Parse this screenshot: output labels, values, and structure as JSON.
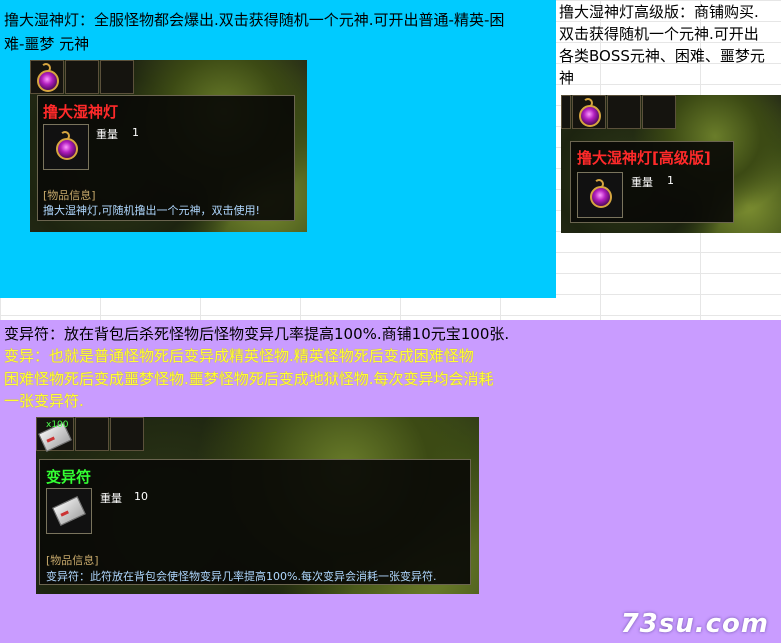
{
  "panel_top_left": {
    "desc_line1": "撸大湿神灯：全服怪物都会爆出.双击获得随机一个元神.可开出普通-精英-困",
    "desc_line2": "难-噩梦 元神",
    "tooltip": {
      "title": "撸大湿神灯",
      "title_color": "#ff2a2a",
      "weight_label": "重量",
      "weight_value": "1",
      "info_label": "[物品信息]",
      "info_text": "撸大湿神灯,可随机撸出一个元神，双击使用!"
    }
  },
  "panel_top_right": {
    "desc_line1": "撸大湿神灯高级版：商铺购买.",
    "desc_line2": "双击获得随机一个元神.可开出",
    "desc_line3": "各类BOSS元神、困难、噩梦元",
    "desc_line4": "神",
    "tooltip": {
      "title": "撸大湿神灯[高级版]",
      "title_color": "#ff2a2a",
      "weight_label": "重量",
      "weight_value": "1"
    }
  },
  "panel_bottom": {
    "desc_line1": "变异符：放在背包后杀死怪物后怪物变异几率提高100%.商铺10元宝100张.",
    "desc_yellow_line1": "变异：也就是普通怪物死后变异成精英怪物.精英怪物死后变成困难怪物",
    "desc_yellow_line2": "困难怪物死后变成噩梦怪物.噩梦怪物死后变成地狱怪物.每次变异均会消耗",
    "desc_yellow_line3": "一张变异符.",
    "slot_count_label": "x100",
    "tooltip": {
      "title": "变异符",
      "title_color": "#33ff33",
      "weight_label": "重量",
      "weight_value": "10",
      "info_label": "[物品信息]",
      "info_text": "变异符：此符放在背包会使怪物变异几率提高100%.每次变异会消耗一张变异符."
    }
  },
  "watermark": "73su.com"
}
